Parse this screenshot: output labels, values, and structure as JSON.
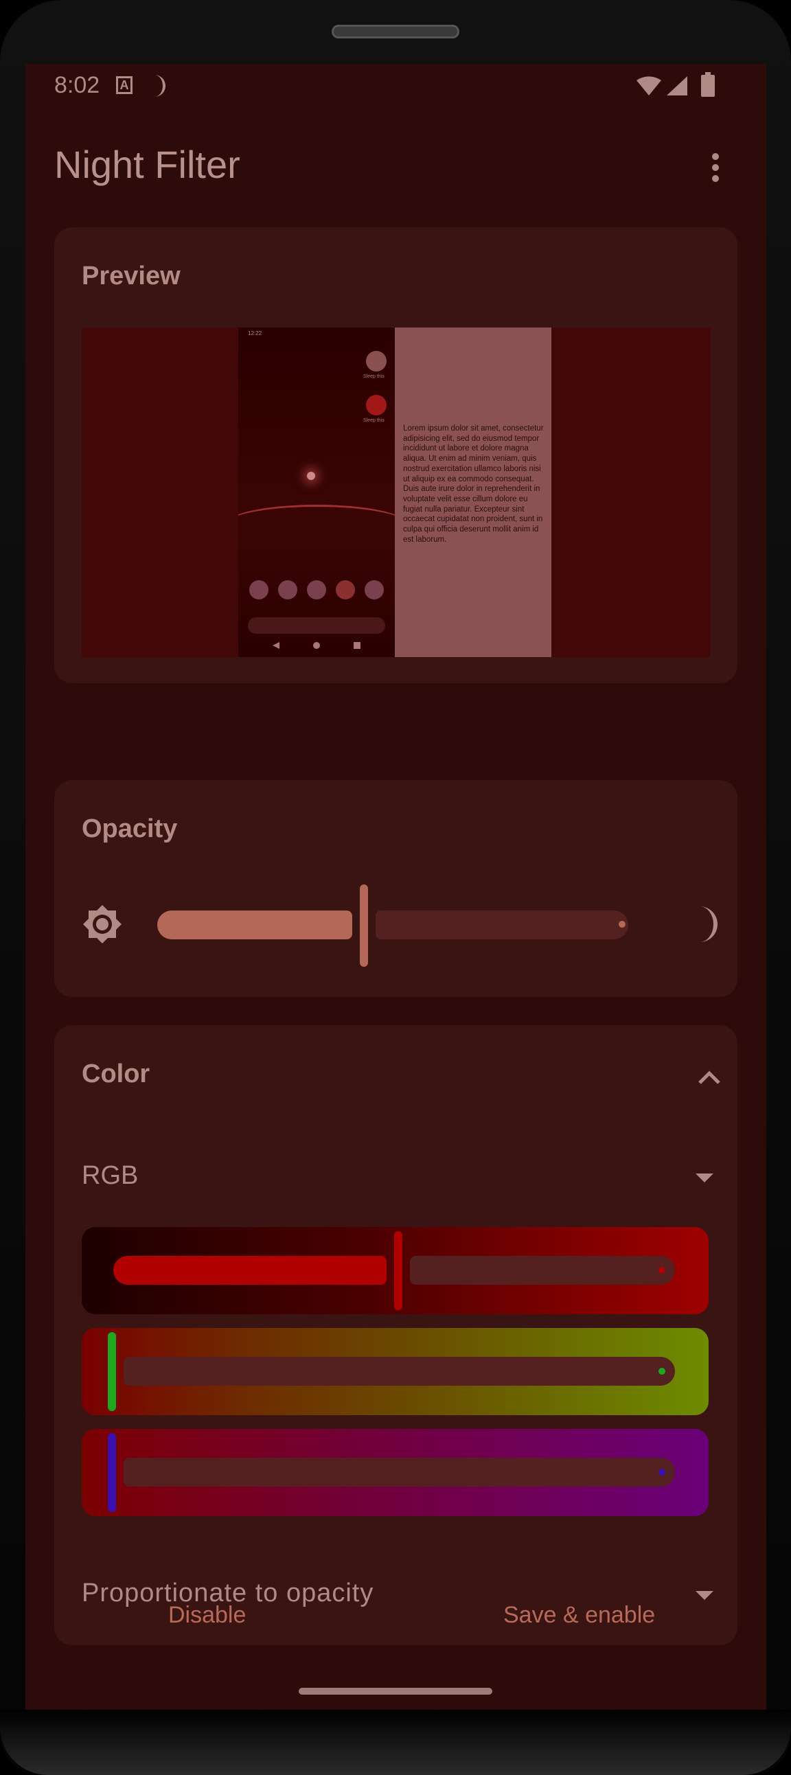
{
  "status_bar": {
    "time": "8:02",
    "notification_icon": "A"
  },
  "app_bar": {
    "title": "Night Filter"
  },
  "preview": {
    "title": "Preview",
    "thumbnail": {
      "status_time": "12:22",
      "caption_1": "Sleep this",
      "caption_2": "Sleep this"
    },
    "sample_text": "Lorem ipsum dolor sit amet, consectetur adipisicing elit, sed do eiusmod tempor incididunt ut labore et dolore magna aliqua. Ut enim ad minim veniam, quis nostrud exercitation ullamco laboris nisi ut aliquip ex ea commodo consequat. Duis aute irure dolor in reprehenderit in voluptate velit esse cillum dolore eu fugiat nulla pariatur. Excepteur sint occaecat cupidatat non proident, sunt in culpa qui officia deserunt mollit anim id est laborum."
  },
  "opacity": {
    "title": "Opacity",
    "value_fraction": 0.43
  },
  "color": {
    "title": "Color",
    "mode": "RGB",
    "sliders": [
      {
        "channel": "red",
        "value_fraction": 0.5,
        "color": "#b00000"
      },
      {
        "channel": "green",
        "value_fraction": 0.0,
        "color": "#1ea81e"
      },
      {
        "channel": "blue",
        "value_fraction": 0.0,
        "color": "#3a10b0"
      }
    ],
    "adjustment_mode": "Proportionate to opacity"
  },
  "actions": {
    "disable": "Disable",
    "save": "Save & enable"
  },
  "colors": {
    "background": "#2e0b0b",
    "card": "#3a1313",
    "accent": "#b36858",
    "text": "#b08a86"
  }
}
